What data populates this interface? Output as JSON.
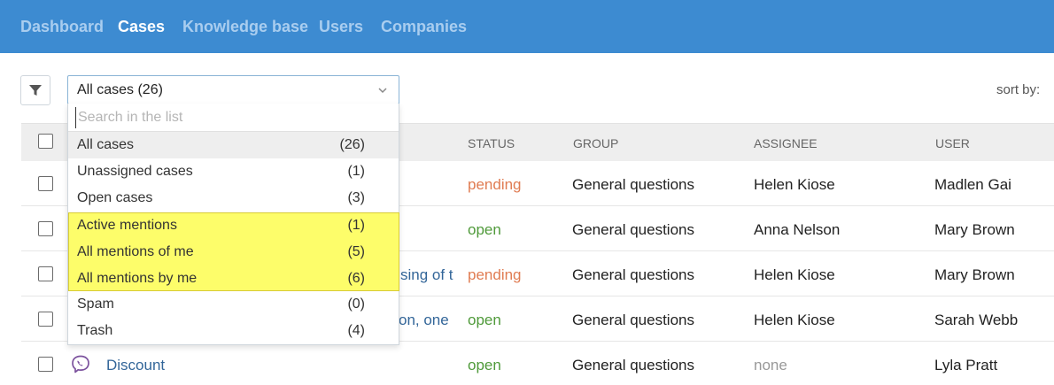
{
  "nav": {
    "items": [
      {
        "label": "Dashboard",
        "active": false
      },
      {
        "label": "Cases",
        "active": true
      },
      {
        "label": "Knowledge base",
        "active": false
      },
      {
        "label": "Users",
        "active": false
      },
      {
        "label": "Companies",
        "active": false
      }
    ]
  },
  "toolbar": {
    "filter_icon": "funnel-icon",
    "sort_label": "sort by:"
  },
  "case_filter": {
    "selected": "All cases (26)",
    "search_placeholder": "Search in the list",
    "options": [
      {
        "label": "All cases",
        "count": "(26)",
        "selected": true,
        "highlighted": false
      },
      {
        "label": "Unassigned cases",
        "count": "(1)",
        "selected": false,
        "highlighted": false
      },
      {
        "label": "Open cases",
        "count": "(3)",
        "selected": false,
        "highlighted": false
      },
      {
        "label": "Active mentions",
        "count": "(1)",
        "selected": false,
        "highlighted": true
      },
      {
        "label": "All mentions of me",
        "count": "(5)",
        "selected": false,
        "highlighted": true
      },
      {
        "label": "All mentions by me",
        "count": "(6)",
        "selected": false,
        "highlighted": true
      },
      {
        "label": "Spam",
        "count": "(0)",
        "selected": false,
        "highlighted": false
      },
      {
        "label": "Trash",
        "count": "(4)",
        "selected": false,
        "highlighted": false
      }
    ],
    "highlight_color": "#fdfd6a"
  },
  "table": {
    "columns": [
      "STATUS",
      "GROUP",
      "ASSIGNEE",
      "USER"
    ],
    "rows": [
      {
        "subject": "",
        "status": "pending",
        "group": "General questions",
        "assignee": "Helen Kiose",
        "user": "Madlen Gai"
      },
      {
        "subject": "",
        "status": "open",
        "group": "General questions",
        "assignee": "Anna Nelson",
        "user": "Mary Brown"
      },
      {
        "subject": "sing of t",
        "status": "pending",
        "group": "General questions",
        "assignee": "Helen Kiose",
        "user": "Mary Brown"
      },
      {
        "subject": "on, one",
        "status": "open",
        "group": "General questions",
        "assignee": "Helen Kiose",
        "user": "Sarah Webb"
      },
      {
        "subject": "Discount",
        "status": "open",
        "group": "General questions",
        "assignee": "none",
        "user": "Lyla Pratt",
        "channel_icon": "viber-icon"
      }
    ]
  },
  "colors": {
    "topbar": "#3d8bd1",
    "pending": "#e07c52",
    "open": "#4f9a3a"
  }
}
